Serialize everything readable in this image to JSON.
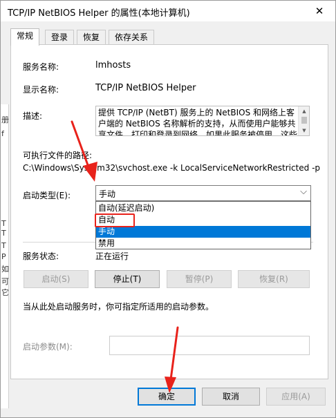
{
  "window": {
    "title": "TCP/IP NetBIOS Helper 的属性(本地计算机)",
    "close_glyph": "✕"
  },
  "background_app": {
    "fragments": [
      "册",
      "f",
      "T",
      "T",
      "T",
      "P",
      "如",
      "可",
      "它"
    ]
  },
  "tabs": [
    {
      "label": "常规",
      "active": true
    },
    {
      "label": "登录",
      "active": false
    },
    {
      "label": "恢复",
      "active": false
    },
    {
      "label": "依存关系",
      "active": false
    }
  ],
  "general": {
    "service_name_label": "服务名称:",
    "service_name_value": "lmhosts",
    "display_name_label": "显示名称:",
    "display_name_value": "TCP/IP NetBIOS Helper",
    "description_label": "描述:",
    "description_value": "提供 TCP/IP (NetBT) 服务上的 NetBIOS 和网络上客户端的 NetBIOS 名称解析的支持，从而使用户能够共享文件、打印和登录到网络。如果此服务被停用，这些",
    "exe_path_label": "可执行文件的路径:",
    "exe_path_value": "C:\\Windows\\System32\\svchost.exe -k LocalServiceNetworkRestricted -p",
    "startup_type_label": "启动类型(E):",
    "startup_type_value": "手动",
    "startup_options": [
      "自动(延迟启动)",
      "自动",
      "手动",
      "禁用"
    ],
    "startup_selected_index": 2,
    "service_status_label": "服务状态:",
    "service_status_value": "正在运行",
    "start_button": "启动(S)",
    "stop_button": "停止(T)",
    "pause_button": "暂停(P)",
    "resume_button": "恢复(R)",
    "hint_text": "当从此处启动服务时，你可指定所适用的启动参数。",
    "start_params_label": "启动参数(M):",
    "start_params_value": ""
  },
  "footer": {
    "ok_button": "确定",
    "cancel_button": "取消",
    "apply_button": "应用(A)"
  },
  "colors": {
    "annotation_red": "#e8221b",
    "selection_blue": "#0078d7"
  }
}
